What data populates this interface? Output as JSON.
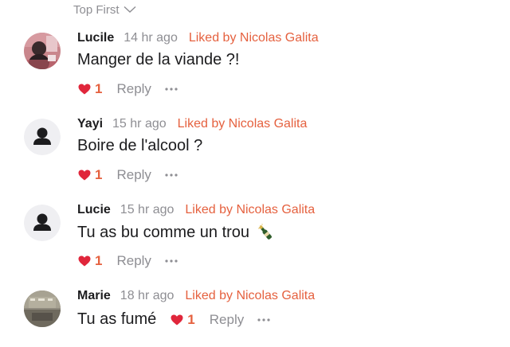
{
  "sort": {
    "label": "Top First"
  },
  "comments": [
    {
      "author": "Lucile",
      "time": "14 hr ago",
      "liked_by": "Liked by Nicolas Galita",
      "text": "Manger de la viande ?!",
      "likes": "1",
      "reply_label": "Reply",
      "avatar": "photo"
    },
    {
      "author": "Yayi",
      "time": "15 hr ago",
      "liked_by": "Liked by Nicolas Galita",
      "text": "Boire de l'alcool ?",
      "likes": "1",
      "reply_label": "Reply",
      "avatar": "default-person-icon"
    },
    {
      "author": "Lucie",
      "time": "15 hr ago",
      "liked_by": "Liked by Nicolas Galita",
      "text": "Tu as bu comme un trou",
      "emoji": "champagne-bottle-icon",
      "likes": "1",
      "reply_label": "Reply",
      "avatar": "default-person-icon"
    },
    {
      "author": "Marie",
      "time": "18 hr ago",
      "liked_by": "Liked by Nicolas Galita",
      "text": "Tu as fumé",
      "likes": "1",
      "reply_label": "Reply",
      "avatar": "photo"
    }
  ],
  "colors": {
    "accent": "#e5613f",
    "heart": "#e0263b",
    "muted": "#8e8e93",
    "text": "#1c1c1e"
  }
}
